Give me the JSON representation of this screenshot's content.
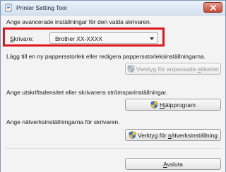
{
  "window": {
    "title": "Printer Setting Tool",
    "close_icon": "close-icon"
  },
  "intro": {
    "text": "Ange avancerade inställningar för den valda skrivaren."
  },
  "printer": {
    "label_prefix": "S",
    "label_rest": "krivare:",
    "selected": "Brother XX-XXXX"
  },
  "paper": {
    "description": "Lägg till en ny pappersstorlek eller redigera pappersstorleksinställningarna.",
    "button_pre": "Verktyg för anpassade ",
    "button_u": "e",
    "button_post": "tiketter",
    "icon": "shield-icon"
  },
  "device": {
    "description": "Ange utskriftsdensitet eller skrivarens strömsparinställningar.",
    "button_u": "H",
    "button_post": "jälpprogram",
    "icon": "shield-icon"
  },
  "network": {
    "description": "Ange nätverksinställningarna för skrivaren.",
    "button_pre": "Verktyg för ",
    "button_u": "n",
    "button_post": "ätverksinställning",
    "icon": "shield-icon"
  },
  "exit": {
    "button_u": "A",
    "button_post": "vsluta"
  },
  "colors": {
    "highlight": "#e0161f",
    "close": "#c74a33"
  }
}
